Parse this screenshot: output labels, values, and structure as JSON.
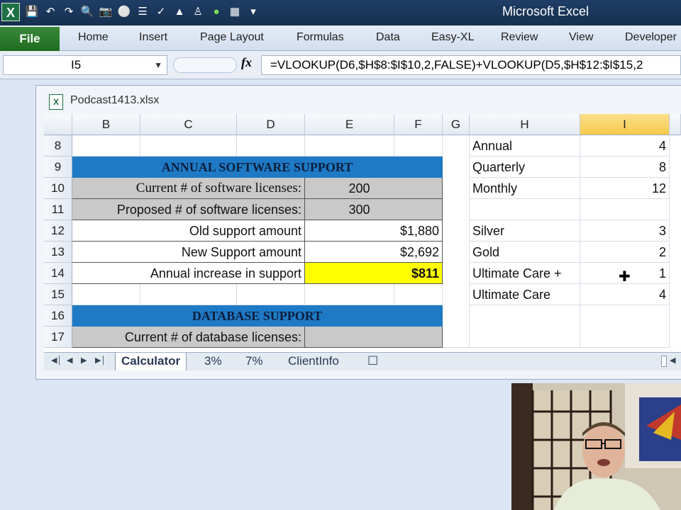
{
  "app": {
    "title": "Microsoft Excel",
    "logo": "X"
  },
  "quick_access": [
    "save-icon",
    "undo-icon",
    "redo-icon",
    "print-preview-icon",
    "camera-icon",
    "circle-icon",
    "filter-icon",
    "check-icon",
    "triangle-icon",
    "person-icon",
    "green-circle-icon",
    "grid-icon",
    "customize-icon"
  ],
  "ribbon": {
    "file": "File",
    "tabs": [
      "Home",
      "Insert",
      "Page Layout",
      "Formulas",
      "Data",
      "Easy-XL",
      "Review",
      "View",
      "Developer"
    ]
  },
  "formula_bar": {
    "name_box": "I5",
    "fx": "fx",
    "formula": "=VLOOKUP(D6,$H$8:$I$10,2,FALSE)+VLOOKUP(D5,$H$12:$I$15,2"
  },
  "workbook": {
    "title": "Podcast1413.xlsx"
  },
  "columns": [
    "B",
    "C",
    "D",
    "E",
    "F",
    "G",
    "H",
    "I"
  ],
  "selected_column": "I",
  "rows": [
    "8",
    "9",
    "10",
    "11",
    "12",
    "13",
    "14",
    "15",
    "16",
    "17"
  ],
  "calc": {
    "section1_title": "ANNUAL SOFTWARE SUPPORT",
    "current_label": "Current # of software licenses:",
    "current_value": "200",
    "proposed_label": "Proposed # of software licenses:",
    "proposed_value": "300",
    "old_label": "Old support amount",
    "old_value": "$1,880",
    "new_label": "New Support amount",
    "new_value": "$2,692",
    "increase_label": "Annual increase in support",
    "increase_value": "$811",
    "section2_title": "DATABASE SUPPORT",
    "db_current_label": "Current # of database licenses:"
  },
  "lookup": [
    {
      "label": "Annual",
      "value": "4"
    },
    {
      "label": "Quarterly",
      "value": "8"
    },
    {
      "label": "Monthly",
      "value": "12"
    },
    {
      "label": "",
      "value": ""
    },
    {
      "label": "Silver",
      "value": "3"
    },
    {
      "label": "Gold",
      "value": "2"
    },
    {
      "label": "Ultimate Care +",
      "value": "1"
    },
    {
      "label": "Ultimate Care",
      "value": "4"
    }
  ],
  "sheets": [
    "Calculator",
    "3%",
    "7%",
    "ClientInfo"
  ],
  "active_sheet": "Calculator",
  "colors": {
    "header_blue": "#1f7ac5",
    "highlight_yellow": "#ffff00",
    "input_gray": "#c9c9c9",
    "selected_header": "#f5c94a"
  }
}
